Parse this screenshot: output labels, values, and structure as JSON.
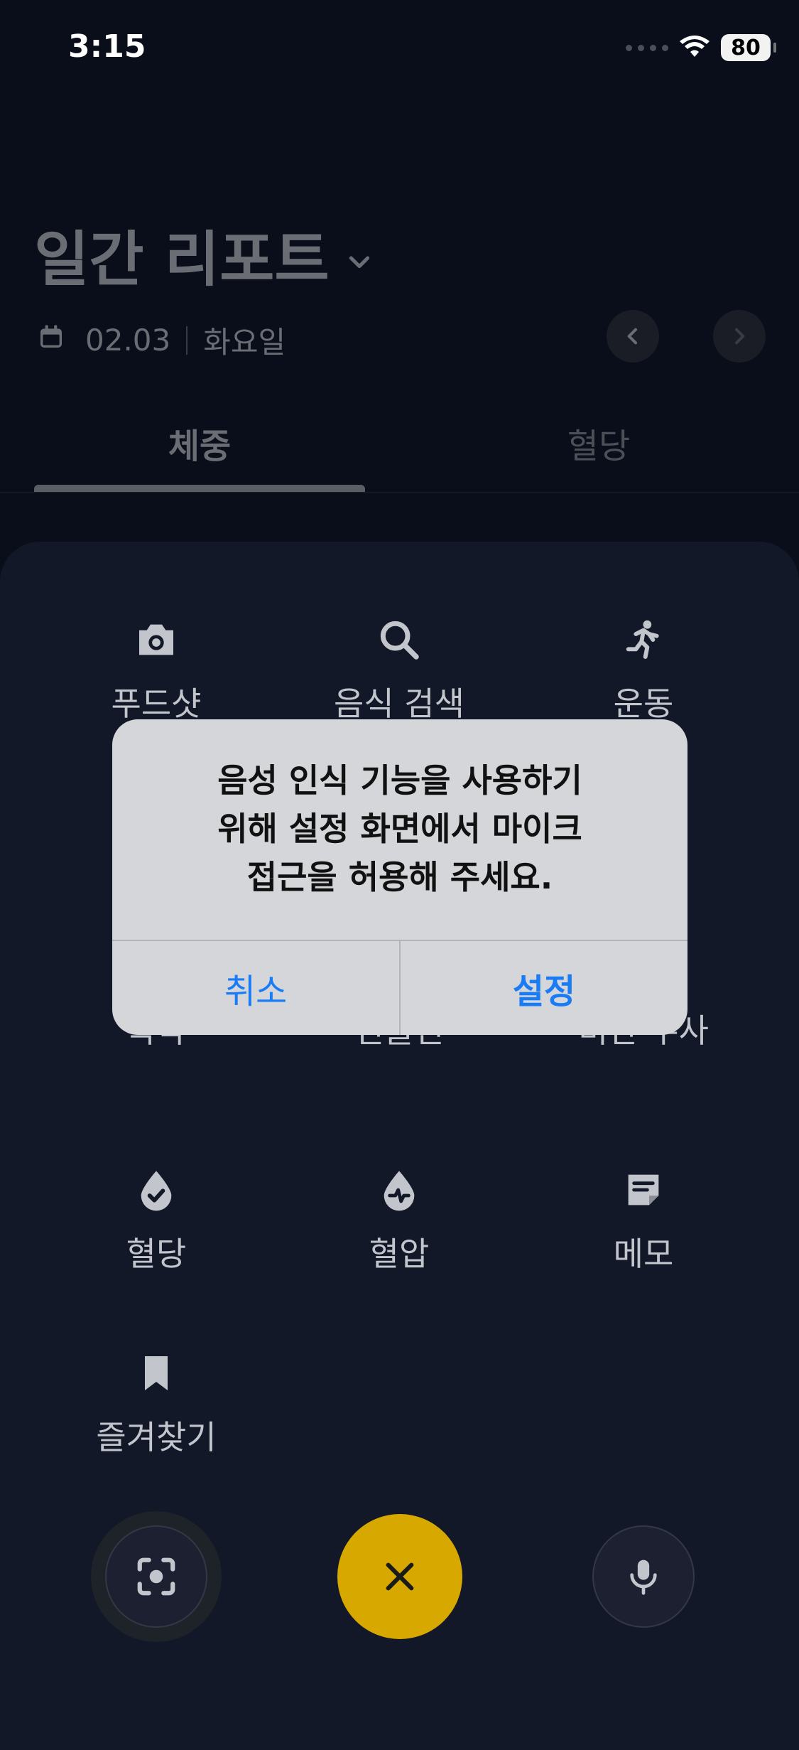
{
  "status": {
    "time": "3:15",
    "battery": "80"
  },
  "header": {
    "title": "일간 리포트",
    "date": "02.03",
    "weekday": "화요일"
  },
  "tabs": [
    {
      "label": "체중"
    },
    {
      "label": "혈당"
    }
  ],
  "menu": [
    {
      "label": "푸드샷",
      "icon": "camera-icon"
    },
    {
      "label": "음식 검색",
      "icon": "search-icon"
    },
    {
      "label": "운동",
      "icon": "running-icon"
    },
    {
      "label": "복약",
      "icon": "pill-icon"
    },
    {
      "label": "인슐린",
      "icon": "syringe-icon"
    },
    {
      "label": "비만 주사",
      "icon": "injection-icon"
    },
    {
      "label": "혈당",
      "icon": "drop-check-icon"
    },
    {
      "label": "혈압",
      "icon": "drop-pulse-icon"
    },
    {
      "label": "메모",
      "icon": "memo-icon"
    },
    {
      "label": "즐겨찾기",
      "icon": "bookmark-icon"
    }
  ],
  "dialog": {
    "line1": "음성 인식 기능을 사용하기",
    "line2": "위해 설정 화면에서 마이크",
    "line3": "접근을 허용해 주세요.",
    "cancel": "취소",
    "confirm": "설정"
  },
  "colors": {
    "accent": "#d6a800",
    "link": "#1a7cf5",
    "background": "#0a0e1a",
    "sheet": "#121828"
  }
}
